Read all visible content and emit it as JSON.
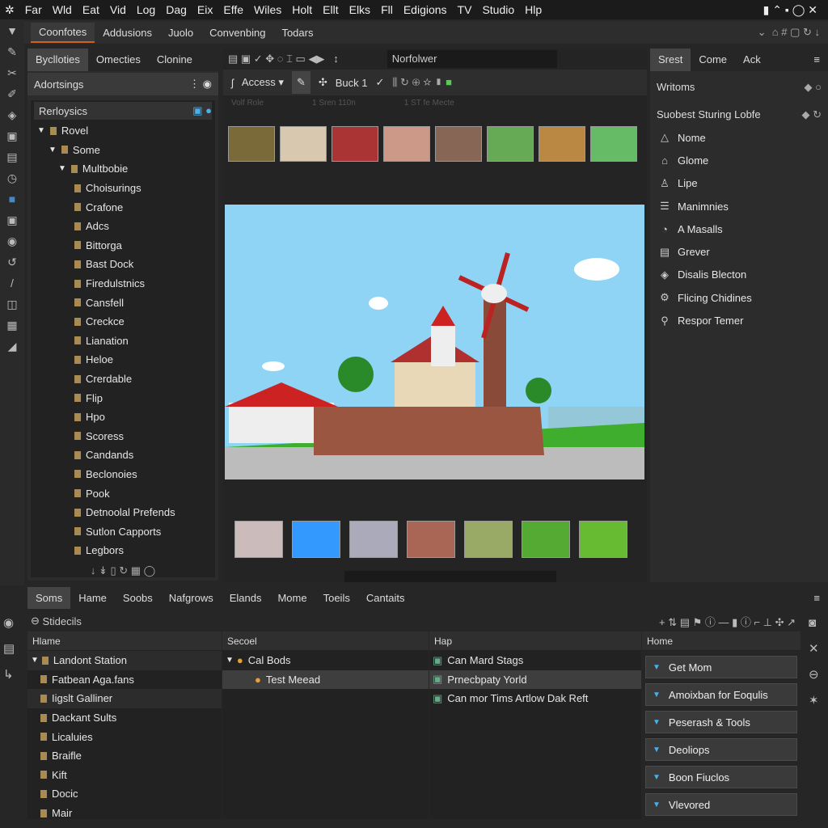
{
  "menu": [
    "Far",
    "Wld",
    "Eat",
    "Vid",
    "Log",
    "Dag",
    "Eix",
    "Effe",
    "Wiles",
    "Holt",
    "Ellt",
    "Elks",
    "Fll",
    "Edigions",
    "TV",
    "Studio",
    "Hlp"
  ],
  "top_tabs": [
    "Coonfotes",
    "Addusions",
    "Juolo",
    "Convenbing",
    "Todars"
  ],
  "left_panel": {
    "tabs": [
      "Byclloties",
      "Omecties",
      "Clonine"
    ],
    "header": "Adortsings",
    "tree_title": "Rerloysics",
    "tree": [
      "Rovel",
      "Some",
      "Multbobie",
      "Choisurings",
      "Crafone",
      "Adcs",
      "Bittorga",
      "Bast Dock",
      "Firedulstnics",
      "Cansfell",
      "Creckce",
      "Lianation",
      "Heloe",
      "Crerdable",
      "Flip",
      "Hpo",
      "Scoress",
      "Candands",
      "Beclonoies",
      "Pook",
      "Detnoolal Prefends",
      "Sutlon Capports",
      "Legbors"
    ]
  },
  "toolbar": {
    "search": "Norfolwer",
    "access": "Access",
    "buck": "Buck 1"
  },
  "ruler": [
    "Volf Role",
    "1 Sren 110n",
    "1 ST fe Mecte"
  ],
  "right_panel": {
    "tabs": [
      "Srest",
      "Come",
      "Ack"
    ],
    "header1": "Writoms",
    "header2": "Suobest Sturing Lobfe",
    "items": [
      {
        "icon": "△",
        "label": "Nome"
      },
      {
        "icon": "⌂",
        "label": "Glome"
      },
      {
        "icon": "♙",
        "label": "Lipe"
      },
      {
        "icon": "☰",
        "label": "Manimnies"
      },
      {
        "icon": "◔",
        "label": "A Masalls"
      },
      {
        "icon": "▤",
        "label": "Grever"
      },
      {
        "icon": "◈",
        "label": "Disalis Blecton"
      },
      {
        "icon": "⚙",
        "label": "Flicing Chidines"
      },
      {
        "icon": "⚲",
        "label": "Respor Temer"
      }
    ]
  },
  "bottom": {
    "tabs": [
      "Soms",
      "Hame",
      "Soobs",
      "Nafgrows",
      "Elands",
      "Mome",
      "Toeils",
      "Cantaits"
    ],
    "sub": "Stidecils",
    "col1": {
      "title": "Hlame",
      "rows": [
        "Landont Station",
        "Fatbean Aga.fans",
        "Iigslt Galliner",
        "Dackant Sults",
        "Licaluies",
        "Braifle",
        "Kift",
        "Docic",
        "Mair"
      ]
    },
    "col2": {
      "title": "Secoel",
      "rows": [
        "Cal Bods",
        "Test Meead"
      ]
    },
    "col3": {
      "title": "Hap",
      "rows": [
        "Can Mard Stags",
        "Prnecbpaty Yorld",
        "Can mor Tims Artlow Dak Reft"
      ]
    },
    "col4": {
      "title": "Home",
      "cards": [
        "Get Mom",
        "Amoixban for Eoqulis",
        "Peserash & Tools",
        "Deoliops",
        "Boon Fiuclos",
        "Vlevored"
      ]
    }
  },
  "colors": {
    "accent": "#d06020",
    "sky": "#8fd3f5",
    "grass": "#3fae2f"
  }
}
